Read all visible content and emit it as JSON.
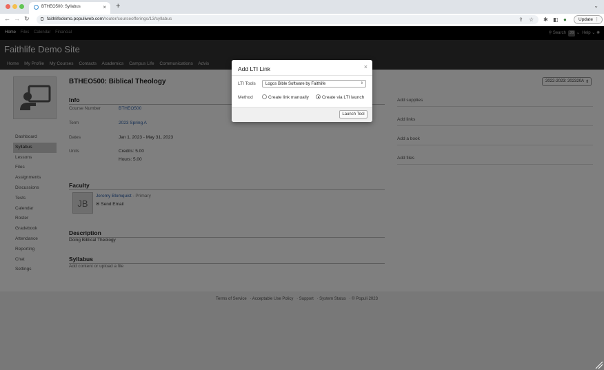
{
  "browser": {
    "tab_title": "BTHEO500: Syllabus",
    "url_host": "faithlifedemo.populiweb.com",
    "url_path": "/router/courseofferings/13/syllabus",
    "update_label": "Update"
  },
  "utility": {
    "links": [
      "Home",
      "Files",
      "Calendar",
      "Financial"
    ],
    "search_label": "Search",
    "user_initials": "JB",
    "help_label": "Help"
  },
  "site": {
    "title": "Faithlife Demo Site",
    "nav": [
      "Home",
      "My Profile",
      "My Courses",
      "Contacts",
      "Academics",
      "Campus Life",
      "Communications",
      "Advis"
    ]
  },
  "course": {
    "title": "BTHEO500: Biblical Theology",
    "term_select": "2022-2023: 202320A"
  },
  "sidebar": {
    "items": [
      "Dashboard",
      "Syllabus",
      "Lessons",
      "Files",
      "Assignments",
      "Discussions",
      "Tests",
      "Calendar",
      "Roster",
      "Gradebook",
      "Attendance",
      "Reporting",
      "Chat",
      "Settings"
    ]
  },
  "info": {
    "heading": "Info",
    "course_number_label": "Course Number",
    "course_number": "BTHEO500",
    "term_label": "Term",
    "term": "2023 Spring A",
    "dates_label": "Dates",
    "dates": "Jan 1, 2023 - May 31, 2023",
    "units_label": "Units",
    "credits": "Credits: 5.00",
    "hours": "Hours: 5.00"
  },
  "faculty": {
    "heading": "Faculty",
    "initials": "JB",
    "name": "Jeromy Blomquist",
    "role": " - Primary",
    "send_email": "Send Email"
  },
  "description": {
    "heading": "Description",
    "text": "Doing Biblical Theology"
  },
  "syllabus": {
    "heading": "Syllabus",
    "text": "Add content or upload a file"
  },
  "aside": {
    "items": [
      "Add supplies",
      "Add links",
      "Add a book",
      "Add files"
    ]
  },
  "footer": {
    "links": [
      "Terms of Service",
      "Acceptable Use Policy",
      "Support",
      "System Status",
      "© Populi 2023"
    ]
  },
  "modal": {
    "title": "Add LTI Link",
    "tools_label": "LTI Tools",
    "tools_value": "Logos Bible Software by Faithlife",
    "method_label": "Method",
    "option_manual": "Create link manually",
    "option_launch": "Create via LTI launch",
    "selected_method": "Create via LTI launch",
    "launch_button": "Launch Tool"
  },
  "colors": {
    "link": "#2b5ea8",
    "brand_bar": "#333333",
    "utility_bar": "#000000"
  }
}
